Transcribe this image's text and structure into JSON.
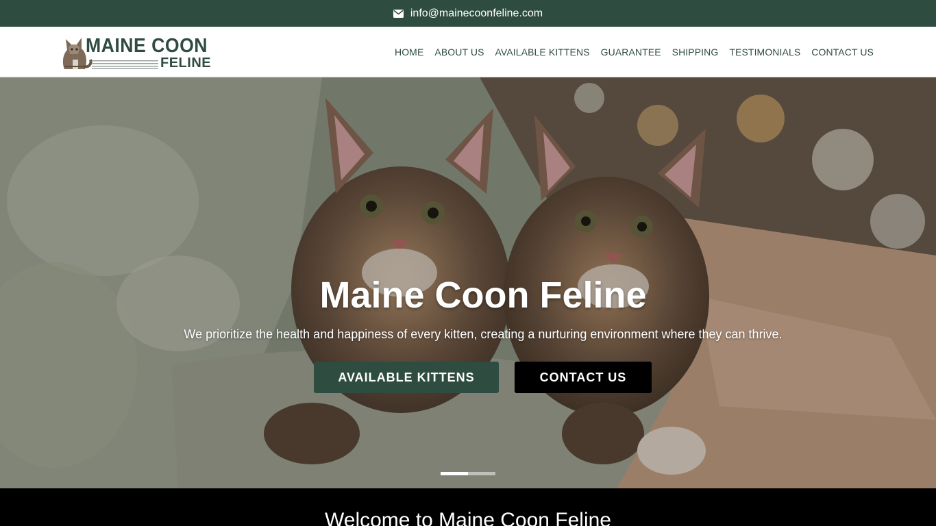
{
  "topbar": {
    "email": "info@mainecoonfeline.com",
    "icon": "envelope-icon",
    "background": "#2f4c40"
  },
  "header": {
    "logo": {
      "line1": "MAINE COON",
      "line2": "FELINE",
      "icon": "maine-coon-cat-icon"
    },
    "nav": [
      {
        "label": "HOME"
      },
      {
        "label": "ABOUT US"
      },
      {
        "label": "AVAILABLE KITTENS"
      },
      {
        "label": "GUARANTEE"
      },
      {
        "label": "SHIPPING"
      },
      {
        "label": "TESTIMONIALS"
      },
      {
        "label": "CONTACT US"
      }
    ],
    "accent": "#2f4c40"
  },
  "hero": {
    "title": "Maine Coon Feline",
    "subtitle": "We prioritize the health and happiness of every kitten, creating a nurturing environment where they can thrive.",
    "buttons": {
      "kittens": "AVAILABLE KITTENS",
      "contact": "CONTACT US"
    },
    "slides_total": 2,
    "active_slide": 1
  },
  "welcome": {
    "title": "Welcome to Maine Coon Feline"
  }
}
